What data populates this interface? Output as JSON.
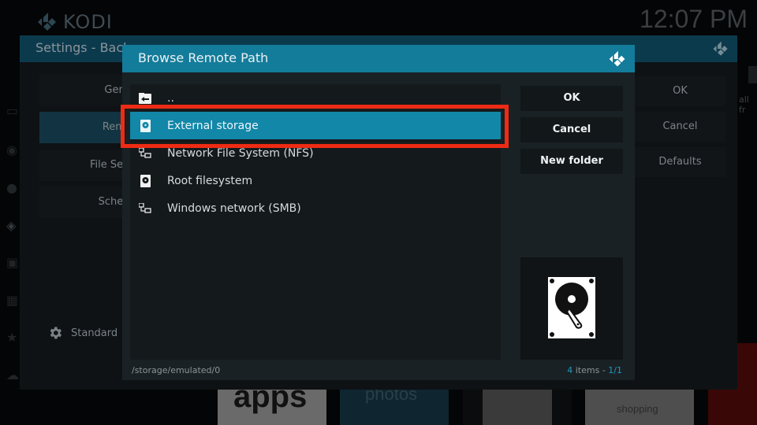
{
  "app": {
    "name": "KODI",
    "clock": "12:07 PM"
  },
  "settings_window": {
    "title": "Settings - Back",
    "categories": [
      {
        "label": "Genera",
        "active": false
      },
      {
        "label": "Remote",
        "active": true
      },
      {
        "label": "File Select",
        "active": false
      },
      {
        "label": "Scheduli",
        "active": false
      }
    ],
    "level": {
      "icon": "gear-icon",
      "label": "Standard"
    },
    "buttons": [
      {
        "label": "OK"
      },
      {
        "label": "Cancel"
      },
      {
        "label": "Defaults"
      }
    ],
    "partial_text_right": "all fr"
  },
  "dialog": {
    "title": "Browse Remote Path",
    "items": [
      {
        "label": "..",
        "icon": "folder-back-icon",
        "selected": false
      },
      {
        "label": "External storage",
        "icon": "hard-drive-icon",
        "selected": true
      },
      {
        "label": "Network File System (NFS)",
        "icon": "network-icon",
        "selected": false
      },
      {
        "label": "Root filesystem",
        "icon": "hard-drive-icon",
        "selected": false
      },
      {
        "label": "Windows network (SMB)",
        "icon": "network-icon",
        "selected": false
      }
    ],
    "buttons": [
      {
        "label": "OK"
      },
      {
        "label": "Cancel"
      },
      {
        "label": "New folder"
      }
    ],
    "preview_icon": "hard-drive-icon",
    "current_path": "/storage/emulated/0",
    "item_count": "4",
    "item_count_suffix": " items - ",
    "page": "1/1"
  },
  "background_tiles": [
    {
      "label": "apps"
    },
    {
      "label": "photos"
    },
    {
      "label": ""
    },
    {
      "label": "shopping"
    }
  ],
  "colors": {
    "accent": "#137c9a",
    "selection": "#1287a8",
    "highlight_annotation": "#ee2b14"
  }
}
